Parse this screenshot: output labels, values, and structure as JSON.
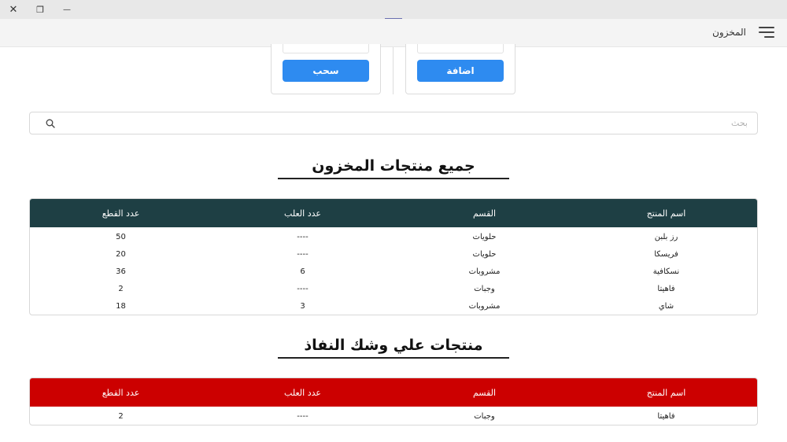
{
  "window": {
    "close_glyph": "✕",
    "restore_glyph": "❐",
    "minimize_glyph": "—"
  },
  "appbar": {
    "title": "المخزون",
    "menu_icon": "hamburger-icon"
  },
  "actions": {
    "add_label": "اضافة",
    "withdraw_label": "سحب",
    "accent": "#2e8bf0"
  },
  "search": {
    "placeholder": "بحث",
    "value": ""
  },
  "all_products": {
    "title": "جميع منتجات المخزون",
    "header_color": "#1e3f44",
    "columns": [
      "اسم المنتج",
      "القسم",
      "عدد العلب",
      "عدد القطع"
    ],
    "rows": [
      [
        "رز بلبن",
        "حلويات",
        "----",
        "50"
      ],
      [
        "فريسكا",
        "حلويات",
        "----",
        "20"
      ],
      [
        "نسكافية",
        "مشروبات",
        "6",
        "36"
      ],
      [
        "فاهيتا",
        "وجبات",
        "----",
        "2"
      ],
      [
        "شاي",
        "مشروبات",
        "3",
        "18"
      ]
    ]
  },
  "low_stock": {
    "title": "منتجات علي وشك النفاذ",
    "header_color": "#cc0000",
    "columns": [
      "اسم المنتج",
      "القسم",
      "عدد العلب",
      "عدد القطع"
    ],
    "rows": [
      [
        "فاهيتا",
        "وجبات",
        "----",
        "2"
      ]
    ]
  }
}
